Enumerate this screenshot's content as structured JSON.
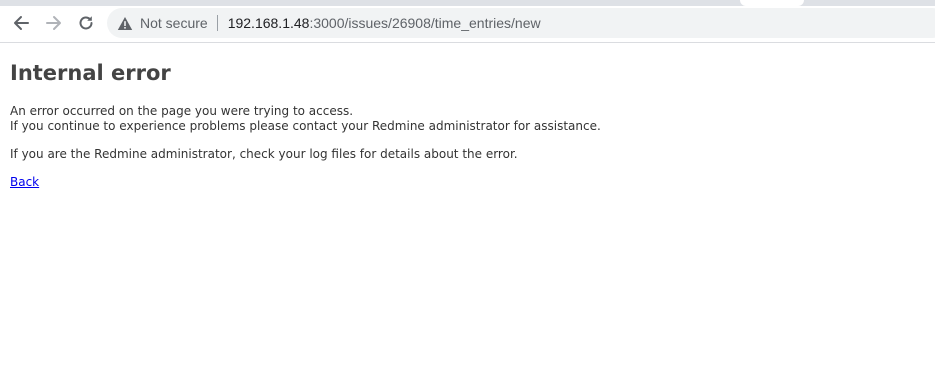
{
  "browser": {
    "security_label": "Not secure",
    "url_host": "192.168.1.48",
    "url_rest": ":3000/issues/26908/time_entries/new",
    "icons": {
      "back": "arrow-left-icon",
      "forward": "arrow-right-icon",
      "reload": "reload-icon",
      "security": "warning-triangle-icon"
    }
  },
  "page": {
    "title": "Internal error",
    "message_line1": "An error occurred on the page you were trying to access.",
    "message_line2": "If you continue to experience problems please contact your Redmine administrator for assistance.",
    "admin_note": "If you are the Redmine administrator, check your log files for details about the error.",
    "back_link": "Back"
  }
}
